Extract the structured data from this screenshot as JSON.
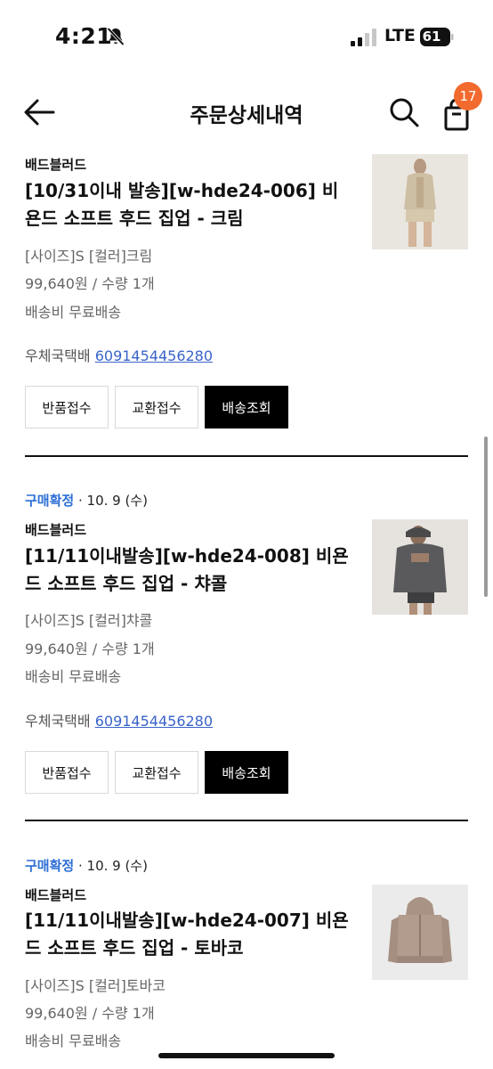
{
  "status_bar": {
    "time": "4:21",
    "network": "LTE",
    "battery": "61"
  },
  "header": {
    "title": "주문상세내역",
    "cart_count": "17"
  },
  "orders": [
    {
      "status": "",
      "date": "",
      "brand": "배드블러드",
      "name": "[10/31이내 발송][w-hde24-006] 비욘드 소프트 후드 집업 - 크림",
      "options": "[사이즈]S [컬러]크림",
      "price_qty": "99,640원 / 수량 1개",
      "shipping": "배송비 무료배송",
      "courier": "우체국택배",
      "tracking": "6091454456280",
      "buttons": [
        "반품접수",
        "교환접수",
        "배송조회"
      ]
    },
    {
      "status": "구매확정",
      "date": "· 10. 9 (수)",
      "brand": "배드블러드",
      "name": "[11/11이내발송][w-hde24-008] 비욘드 소프트 후드 집업 - 챠콜",
      "options": "[사이즈]S [컬러]챠콜",
      "price_qty": "99,640원 / 수량 1개",
      "shipping": "배송비 무료배송",
      "courier": "우체국택배",
      "tracking": "6091454456280",
      "buttons": [
        "반품접수",
        "교환접수",
        "배송조회"
      ]
    },
    {
      "status": "구매확정",
      "date": "· 10. 9 (수)",
      "brand": "배드블러드",
      "name": "[11/11이내발송][w-hde24-007] 비욘드 소프트 후드 집업 - 토바코",
      "options": "[사이즈]S [컬러]토바코",
      "price_qty": "99,640원 / 수량 1개",
      "shipping": "배송비 무료배송"
    }
  ],
  "colors": {
    "accent": "#2c6ed6",
    "badge": "#f26a2e",
    "link": "#3a63c9",
    "primary_button": "#000000"
  }
}
